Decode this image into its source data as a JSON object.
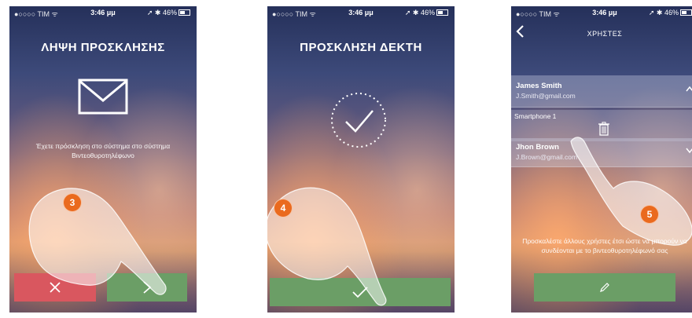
{
  "status_bar": {
    "carrier": "●○○○○ TIM ᯤ",
    "time": "3:46 μμ",
    "battery": "➚ ✱ 46%"
  },
  "panel1": {
    "title": "ΛΗΨΗ ΠΡΟΣΚΛΗΣΗΣ",
    "invite_text": "Έχετε πρόσκληση στο σύστημα στο σύστημα Βιντεοθυροτηλέφωνο",
    "reject_icon": "close-icon",
    "accept_icon": "chevron-right-icon",
    "step": "3"
  },
  "panel2": {
    "title": "ΠΡΟΣΚΛΗΣΗ ΔΕΚΤΗ",
    "confirm_icon": "check-icon",
    "step": "4"
  },
  "panel3": {
    "title": "ΧΡΗΣΤΕΣ",
    "users": [
      {
        "name": "James Smith",
        "email": "J.Smith@gmail.com",
        "chevron": "chevron-up-icon"
      },
      {
        "name": "Jhon Brown",
        "email": "J.Brown@gmail.com",
        "chevron": "chevron-down-icon"
      }
    ],
    "device": {
      "name": "Smartphone 1",
      "icon": "trash-icon"
    },
    "invite_text": "Προσκαλέστε άλλους χρήστες έτσι ώστε να μπορούν να συνδέονται με το βιντεοθυροτηλέφωνό σας",
    "invite_icon": "pencil-icon",
    "step": "5"
  },
  "colors": {
    "reject": "#d9575f",
    "accept": "#6b9e66",
    "step_badge": "#ea6a1e"
  }
}
